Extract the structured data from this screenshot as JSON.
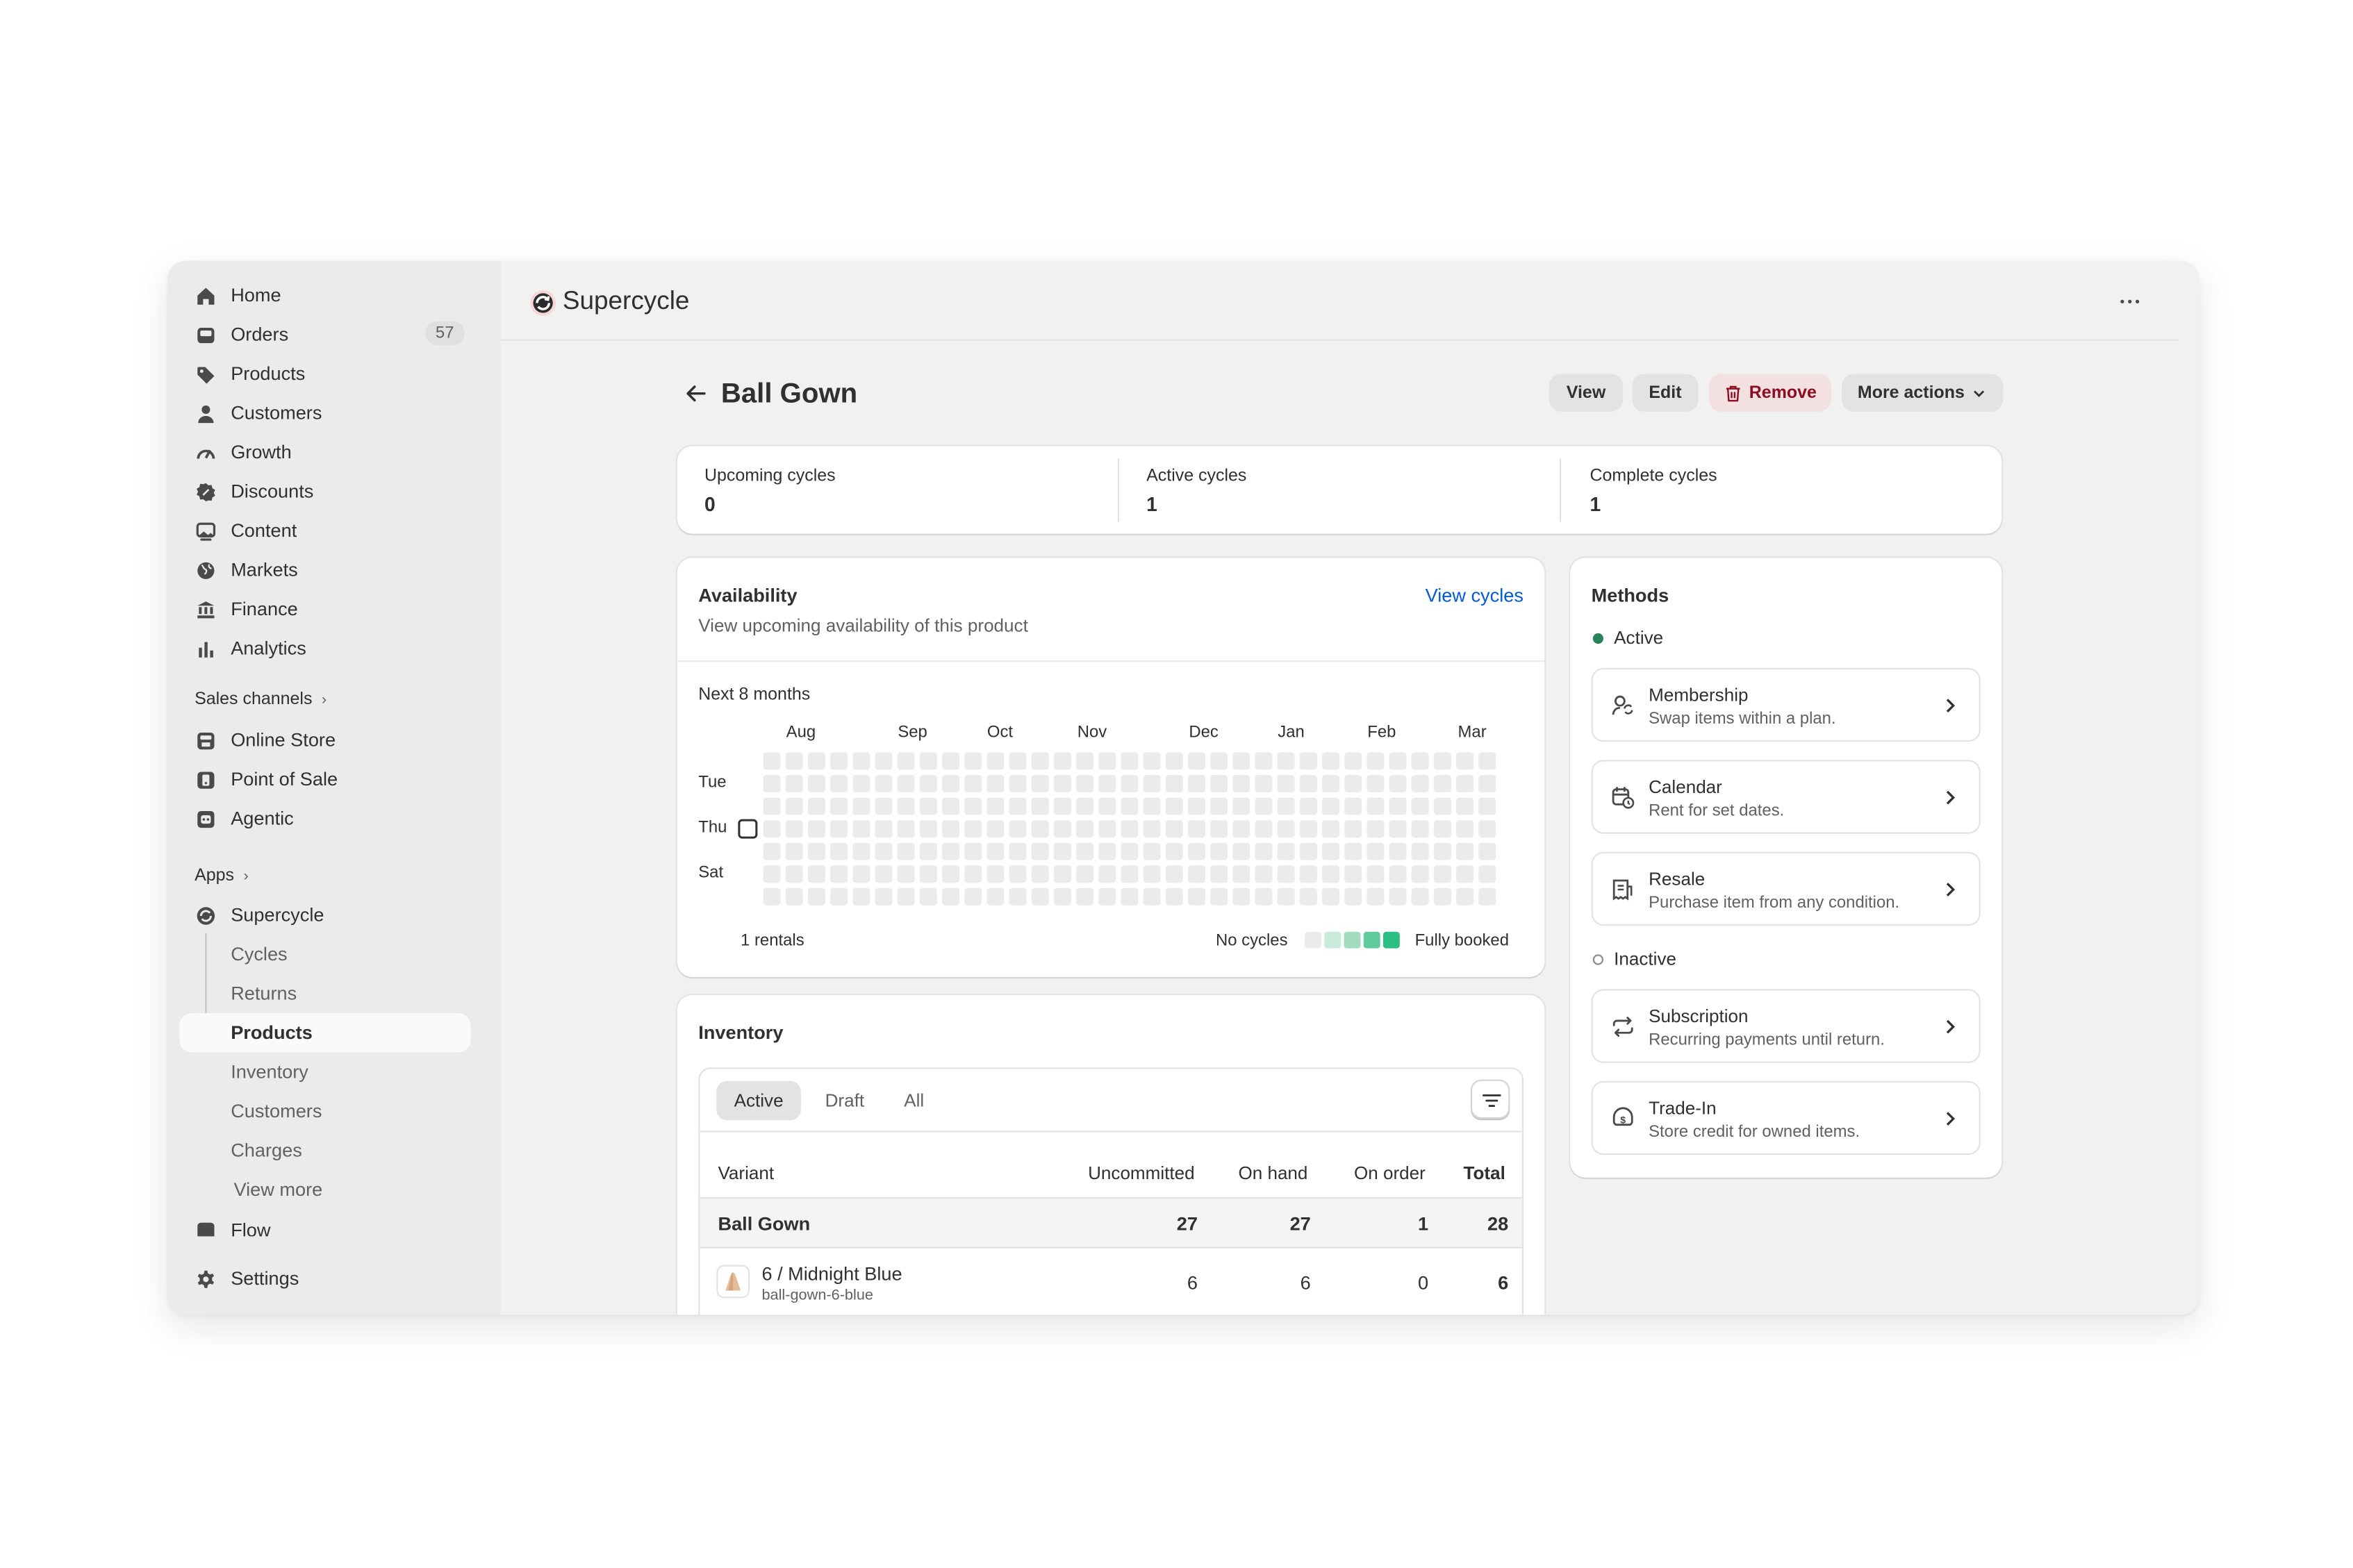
{
  "sidebar": {
    "items": [
      {
        "label": "Home",
        "icon": "home-icon"
      },
      {
        "label": "Orders",
        "icon": "inbox-icon",
        "badge": "57"
      },
      {
        "label": "Products",
        "icon": "tag-icon"
      },
      {
        "label": "Customers",
        "icon": "person-icon"
      },
      {
        "label": "Growth",
        "icon": "gauge-icon"
      },
      {
        "label": "Discounts",
        "icon": "discount-icon"
      },
      {
        "label": "Content",
        "icon": "image-icon"
      },
      {
        "label": "Markets",
        "icon": "globe-icon"
      },
      {
        "label": "Finance",
        "icon": "bank-icon"
      },
      {
        "label": "Analytics",
        "icon": "bar-chart-icon"
      }
    ],
    "sales_channels_label": "Sales channels",
    "channels": [
      {
        "label": "Online Store",
        "icon": "store-icon"
      },
      {
        "label": "Point of Sale",
        "icon": "pos-icon"
      },
      {
        "label": "Agentic",
        "icon": "robot-icon"
      }
    ],
    "apps_label": "Apps",
    "app_name": "Supercycle",
    "app_subitems": [
      "Cycles",
      "Returns",
      "Products",
      "Inventory",
      "Customers",
      "Charges"
    ],
    "view_more": "View more",
    "flow": "Flow",
    "settings": "Settings"
  },
  "header": {
    "app_title": "Supercycle",
    "more_icon": "ellipsis-icon"
  },
  "page": {
    "title": "Ball Gown",
    "actions": {
      "view": "View",
      "edit": "Edit",
      "remove": "Remove",
      "more": "More actions"
    }
  },
  "stats": [
    {
      "label": "Upcoming cycles",
      "value": "0"
    },
    {
      "label": "Active cycles",
      "value": "1"
    },
    {
      "label": "Complete cycles",
      "value": "1"
    }
  ],
  "availability": {
    "title": "Availability",
    "subtitle": "View upcoming availability of this product",
    "link": "View cycles",
    "period": "Next 8 months",
    "months": [
      "Aug",
      "Sep",
      "Oct",
      "Nov",
      "Dec",
      "Jan",
      "Feb",
      "Mar"
    ],
    "days": [
      "Tue",
      "Thu",
      "Sat"
    ],
    "rentals": "1 rentals",
    "legend_start": "No cycles",
    "legend_end": "Fully booked",
    "legend_colors": [
      "#ebebeb",
      "#c8ead9",
      "#a2dcbe",
      "#5fcb9a",
      "#2cbf84"
    ],
    "cell_color": "#ebebeb"
  },
  "inventory": {
    "title": "Inventory",
    "tabs": [
      "Active",
      "Draft",
      "All"
    ],
    "columns": [
      "Variant",
      "Uncommitted",
      "On hand",
      "On order",
      "Total"
    ],
    "group": {
      "name": "Ball Gown",
      "uncommitted": "27",
      "on_hand": "27",
      "on_order": "1",
      "total": "28"
    },
    "rows": [
      {
        "name": "6 / Midnight Blue",
        "sku": "ball-gown-6-blue",
        "uncommitted": "6",
        "on_hand": "6",
        "on_order": "0",
        "total": "6"
      }
    ]
  },
  "methods": {
    "title": "Methods",
    "active_label": "Active",
    "inactive_label": "Inactive",
    "active": [
      {
        "title": "Membership",
        "desc": "Swap items within a plan.",
        "icon": "membership-icon"
      },
      {
        "title": "Calendar",
        "desc": "Rent for set dates.",
        "icon": "calendar-icon"
      },
      {
        "title": "Resale",
        "desc": "Purchase item from any condition.",
        "icon": "receipt-icon"
      }
    ],
    "inactive": [
      {
        "title": "Subscription",
        "desc": "Recurring payments until return.",
        "icon": "repeat-icon"
      },
      {
        "title": "Trade-In",
        "desc": "Store credit for owned items.",
        "icon": "credit-icon"
      }
    ]
  },
  "colors": {
    "accent_link": "#005bd3",
    "danger": "#8e0b21",
    "active_dot": "#29845a"
  }
}
